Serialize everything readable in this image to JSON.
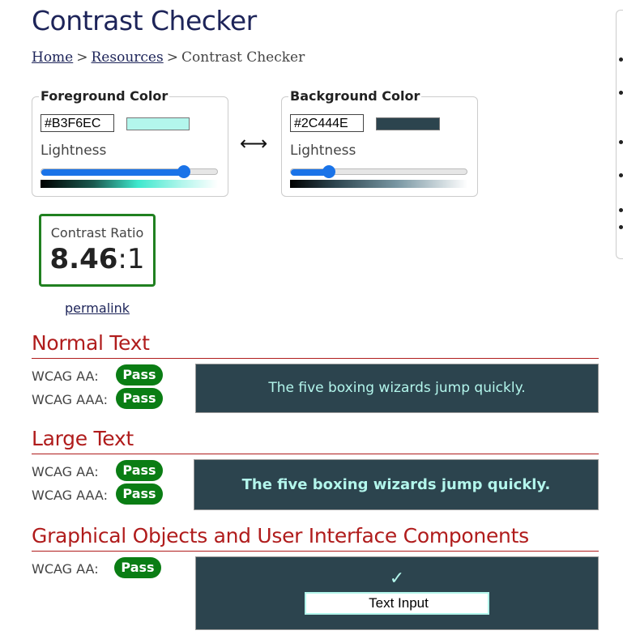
{
  "page": {
    "title": "Contrast Checker"
  },
  "breadcrumb": {
    "home": "Home",
    "separator": ">",
    "resources": "Resources",
    "current": "Contrast Checker"
  },
  "foreground": {
    "legend": "Foreground Color",
    "hex": "#B3F6EC",
    "swatch_color": "#B3F6EC",
    "lightness_label": "Lightness",
    "lightness_value": 0.81
  },
  "background": {
    "legend": "Background Color",
    "hex": "#2C444E",
    "swatch_color": "#2C444E",
    "lightness_label": "Lightness",
    "lightness_value": 0.22
  },
  "swap": {
    "icon": "double-arrow-icon",
    "glyph": "⟷"
  },
  "contrast": {
    "label": "Contrast Ratio",
    "ratio": "8.46",
    "suffix": ":1"
  },
  "permalink": "permalink",
  "normal_text": {
    "title": "Normal Text",
    "aa_label": "WCAG AA:",
    "aa_result": "Pass",
    "aaa_label": "WCAG AAA:",
    "aaa_result": "Pass",
    "sample": "The five boxing wizards jump quickly."
  },
  "large_text": {
    "title": "Large Text",
    "aa_label": "WCAG AA:",
    "aa_result": "Pass",
    "aaa_label": "WCAG AAA:",
    "aaa_result": "Pass",
    "sample": "The five boxing wizards jump quickly."
  },
  "graphical": {
    "title": "Graphical Objects and User Interface Components",
    "aa_label": "WCAG AA:",
    "aa_result": "Pass",
    "check_glyph": "✓",
    "input_value": "Text Input"
  },
  "colors": {
    "pass": "#0a7d14",
    "section_title": "#b01c1c",
    "accent": "#1a73e8",
    "ratio_border": "#208020"
  }
}
